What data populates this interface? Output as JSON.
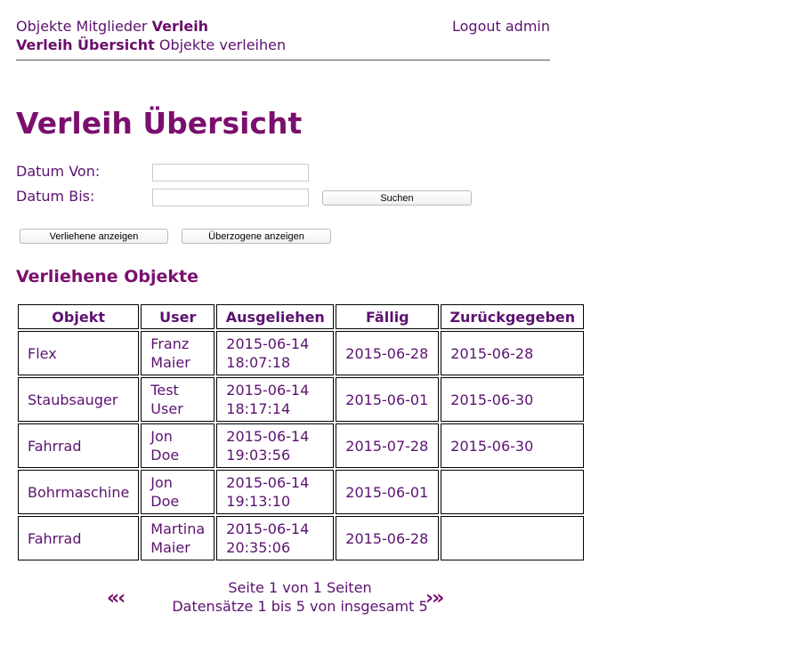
{
  "nav": {
    "row1": [
      "Objekte",
      "Mitglieder",
      "Verleih"
    ],
    "row1_active": "Verleih",
    "row2": [
      "Verleih Übersicht",
      "Objekte verleihen"
    ],
    "row2_active": "Verleih Übersicht",
    "logout": "Logout admin"
  },
  "page": {
    "title": "Verleih Übersicht"
  },
  "filter": {
    "from_label": "Datum Von:",
    "from_value": "",
    "to_label": "Datum Bis:",
    "to_value": "",
    "search_button": "Suchen",
    "show_lent_button": "Verliehene anzeigen",
    "show_overdue_button": "Überzogene anzeigen"
  },
  "section": {
    "title": "Verliehene Objekte"
  },
  "table": {
    "headers": [
      "Objekt",
      "User",
      "Ausgeliehen",
      "Fällig",
      "Zurückgegeben"
    ],
    "rows": [
      {
        "object": "Flex",
        "user_first": "Franz",
        "user_last": "Maier",
        "lent_date": "2015-06-14",
        "lent_time": "18:07:18",
        "due": "2015-06-28",
        "returned": "2015-06-28",
        "lent_faded": false
      },
      {
        "object": "Staubsauger",
        "user_first": "Test",
        "user_last": "User",
        "lent_date": "2015-06-14",
        "lent_time": "18:17:14",
        "due": "2015-06-01",
        "returned": "2015-06-30",
        "lent_faded": false
      },
      {
        "object": "Fahrrad",
        "user_first": "Jon",
        "user_last": "Doe",
        "lent_date": "2015-06-14",
        "lent_time": "19:03:56",
        "due": "2015-07-28",
        "returned": "2015-06-30",
        "lent_faded": true
      },
      {
        "object": "Bohrmaschine",
        "user_first": "Jon",
        "user_last": "Doe",
        "lent_date": "2015-06-14",
        "lent_time": "19:13:10",
        "due": "2015-06-01",
        "returned": "",
        "lent_faded": false
      },
      {
        "object": "Fahrrad",
        "user_first": "Martina",
        "user_last": "Maier",
        "lent_date": "2015-06-14",
        "lent_time": "20:35:06",
        "due": "2015-06-28",
        "returned": "",
        "lent_faded": true
      }
    ]
  },
  "pagination": {
    "prev_icon": "«‹",
    "next_icon": "›»",
    "page_info": "Seite 1 von 1 Seiten",
    "records_info": "Datensätze 1 bis 5 von insgesamt 5"
  }
}
